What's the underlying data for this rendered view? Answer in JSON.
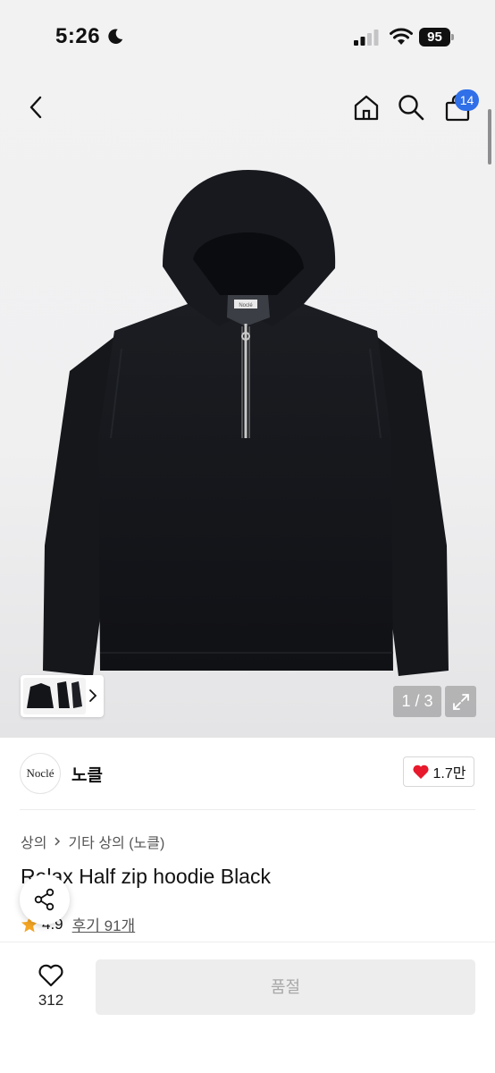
{
  "status_bar": {
    "time": "5:26",
    "battery": "95",
    "icons": [
      "moon-icon",
      "signal-icon",
      "wifi-icon",
      "battery-icon"
    ]
  },
  "nav": {
    "icons": [
      "back-chevron-icon",
      "home-icon",
      "search-icon",
      "shopping-bag-icon"
    ],
    "cart_count": "14"
  },
  "gallery": {
    "hoodie_tag": "Noclé",
    "page_indicator": "1 / 3"
  },
  "brand": {
    "logo_text": "Noclé",
    "name": "노클",
    "likes": "1.7만"
  },
  "breadcrumb": {
    "category": "상의",
    "subcategory": "기타 상의 (노클)"
  },
  "product": {
    "title": "Relax Half zip hoodie Black",
    "rating": "4.9",
    "reviews": "후기 91개"
  },
  "bottom_bar": {
    "wishlist_count": "312",
    "buy_label": "품절"
  },
  "colors": {
    "accent": "#2f6fe8",
    "like_heart": "#e8192c",
    "star": "#f5a623",
    "disabled_button": "#ededed"
  }
}
